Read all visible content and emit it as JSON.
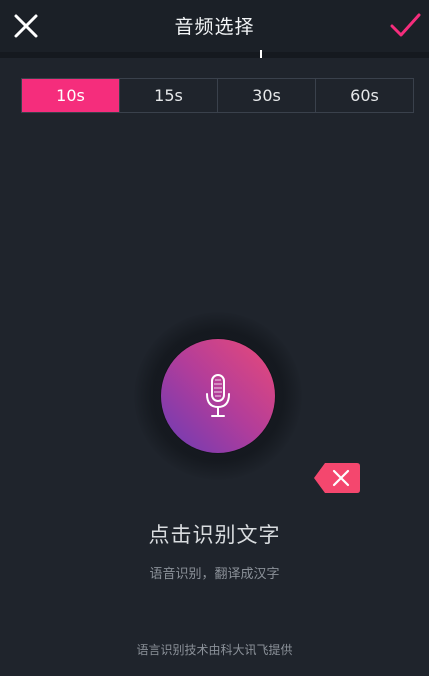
{
  "header": {
    "title": "音频选择",
    "close_icon": "close-icon",
    "confirm_icon": "checkmark-icon",
    "accent_color": "#f52d7c"
  },
  "duration": {
    "options": [
      "10s",
      "15s",
      "30s",
      "60s"
    ],
    "selected": "10s"
  },
  "recognition": {
    "mic_icon": "microphone-icon",
    "delete_icon": "delete-tag-icon",
    "main_hint": "点击识别文字",
    "sub_hint": "语音识别，翻译成汉字"
  },
  "footer": {
    "note": "语言识别技术由科大讯飞提供"
  }
}
